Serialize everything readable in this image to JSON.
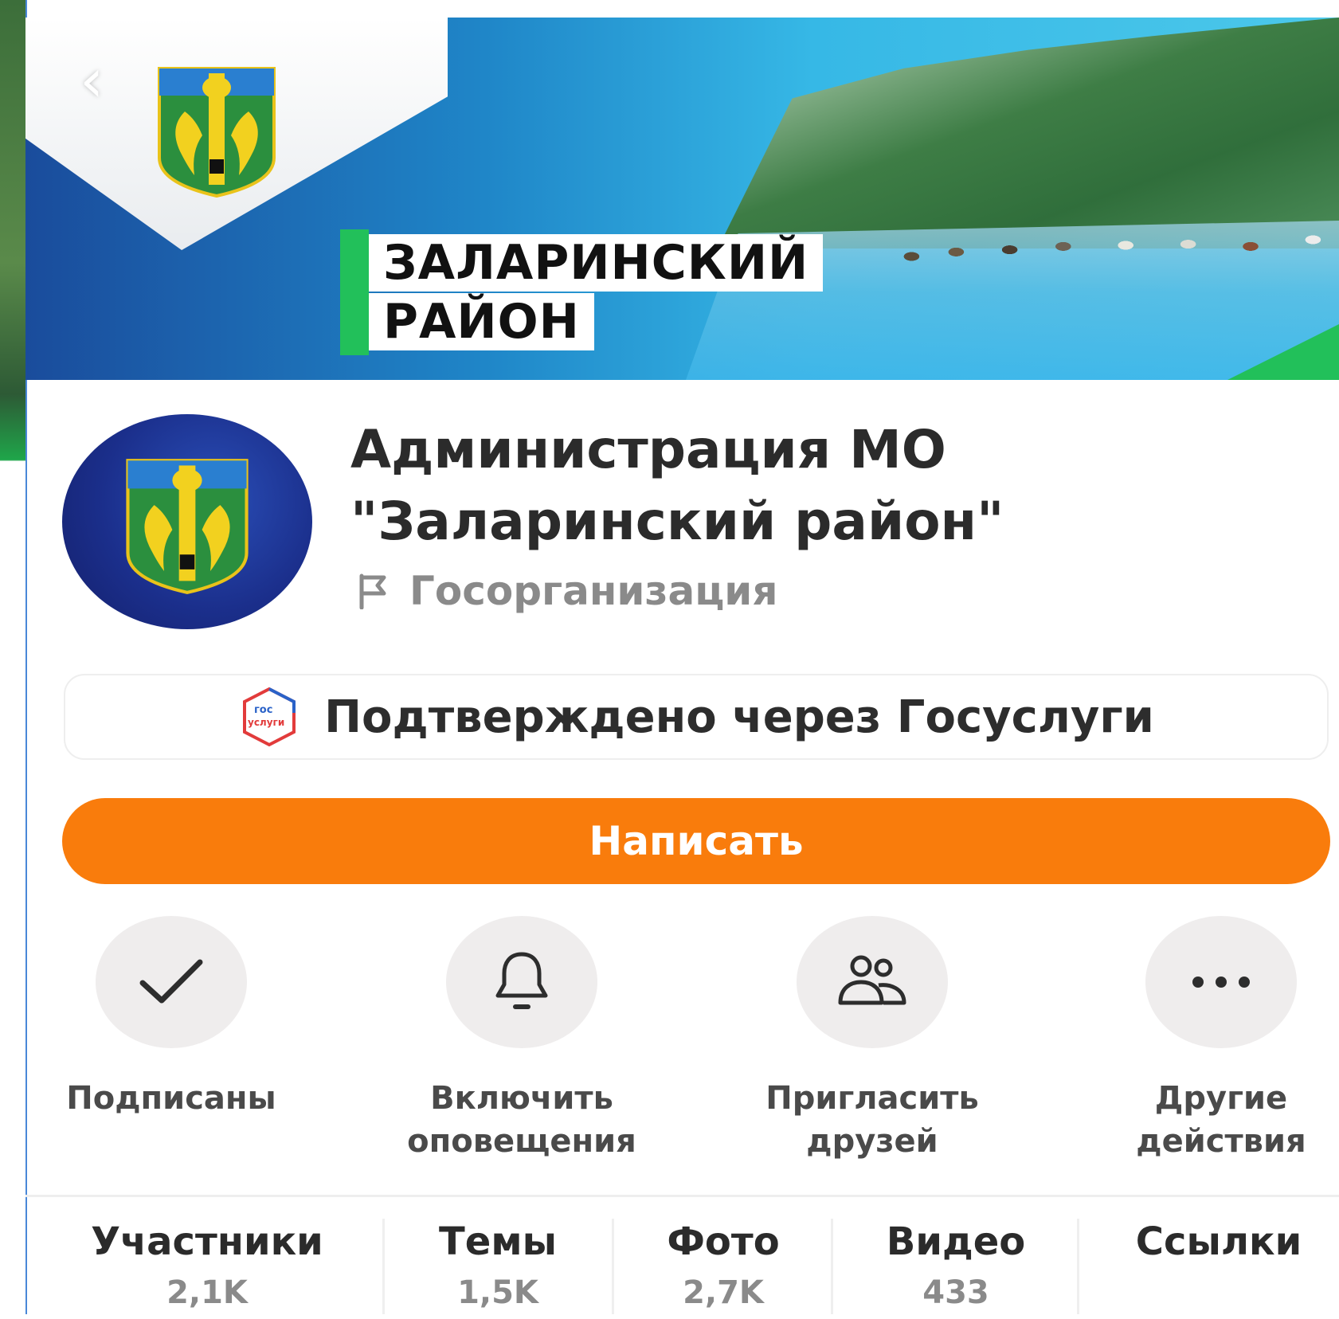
{
  "cover": {
    "banner_line1": "ЗАЛАРИНСКИЙ",
    "banner_line2": "РАЙОН",
    "back_icon": "chevron-left-icon"
  },
  "profile": {
    "name": "Администрация МО \"Заларинский район\"",
    "type": "Госорганизация",
    "type_icon": "flag-icon"
  },
  "verification": {
    "label": "Подтверждено через Госуслуги",
    "icon_text_top": "гос",
    "icon_text_bottom": "услуги"
  },
  "primary_action": {
    "label": "Написать"
  },
  "actions": [
    {
      "label": "Подписаны",
      "icon": "check-icon"
    },
    {
      "label": "Включить\nоповещения",
      "icon": "bell-icon"
    },
    {
      "label": "Пригласить\nдрузей",
      "icon": "people-icon"
    },
    {
      "label": "Другие\nдействия",
      "icon": "more-icon"
    }
  ],
  "stats": [
    {
      "label": "Участники",
      "value": "2,1K"
    },
    {
      "label": "Темы",
      "value": "1,5K"
    },
    {
      "label": "Фото",
      "value": "2,7K"
    },
    {
      "label": "Видео",
      "value": "433"
    },
    {
      "label": "Ссылки",
      "value": ""
    }
  ],
  "colors": {
    "accent_orange": "#f97c0c",
    "banner_green": "#22c05a",
    "avatar_blue": "#1b2f8c"
  }
}
